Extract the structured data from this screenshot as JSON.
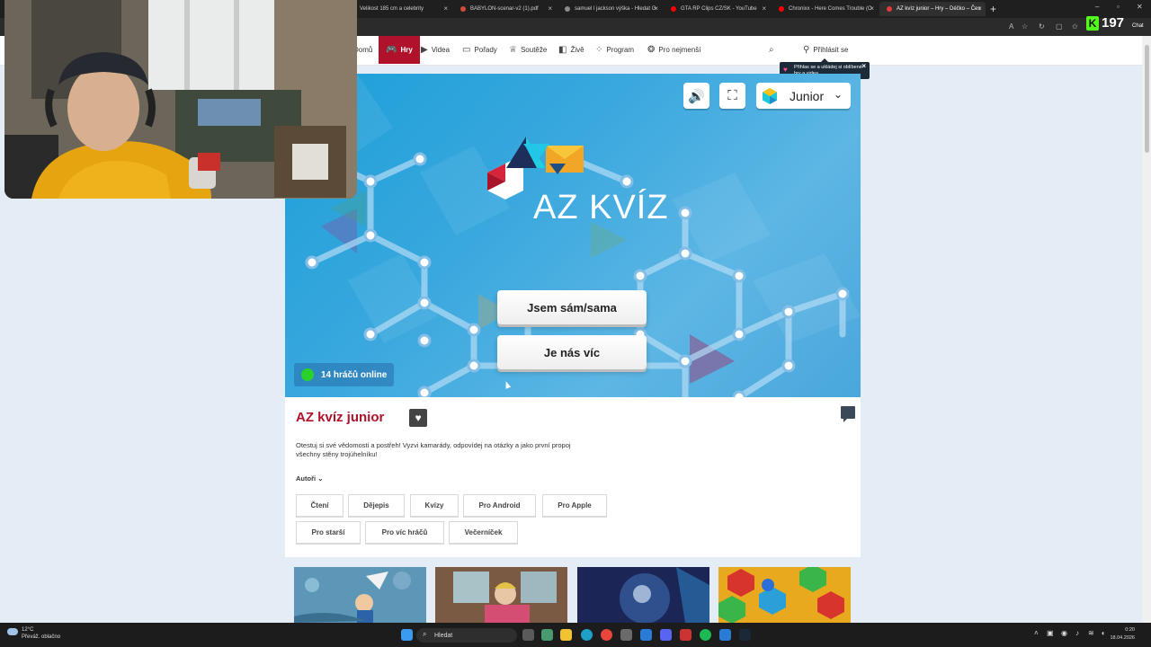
{
  "browser": {
    "tabs": [
      {
        "label": "Velikost 185 cm a celebrity",
        "fav": "#8a8a8a"
      },
      {
        "label": "BABYLON-scenar-v2 (1).pdf",
        "fav": "#d24b3a"
      },
      {
        "label": "samuel l jackson výška - Hledat G",
        "fav": "#8a8a8a"
      },
      {
        "label": "GTA RP Clips CZ/SK - YouTube",
        "fav": "#ff0000"
      },
      {
        "label": "Chronixx - Here Comes Trouble (O",
        "fav": "#ff0000"
      },
      {
        "label": "AZ kvíz junior – Hry – Déčko – Čes",
        "fav": "#e23b3b"
      }
    ],
    "new_tab": "+",
    "kick_count": "197",
    "kick_logo": "K",
    "chat_label": "Chat"
  },
  "nav": {
    "items": [
      {
        "label": "Domů",
        "icon": "home-icon"
      },
      {
        "label": "Hry",
        "icon": "gamepad-icon"
      },
      {
        "label": "Videa",
        "icon": "play-icon"
      },
      {
        "label": "Pořady",
        "icon": "tv-icon"
      },
      {
        "label": "Soutěže",
        "icon": "trophy-icon"
      },
      {
        "label": "Živě",
        "icon": "live-icon"
      },
      {
        "label": "Program",
        "icon": "grid-icon"
      },
      {
        "label": "Pro nejmenší",
        "icon": "bear-icon"
      }
    ],
    "login_label": "Přihlásit se"
  },
  "tooltip": {
    "text": "Přihlas se a ukládej si oblíbené hry a videa."
  },
  "game": {
    "logo_text": "AZ KVÍZ",
    "level": "Junior",
    "choices": [
      "Jsem sám/sama",
      "Je nás víc"
    ],
    "online_text": "14 hráčů online"
  },
  "info": {
    "title": "AZ kvíz junior",
    "description": "Otestuj si své vědomosti a postřeh! Vyzvi kamarády, odpovídej na otázky a jako první propoj všechny stěny trojúhelníku!",
    "authors_label": "Autoři",
    "tags": [
      "Čtení",
      "Dějepis",
      "Kvízy",
      "Pro Android",
      "Pro Apple",
      "Pro starší",
      "Pro víc hráčů",
      "Večerníček"
    ]
  },
  "taskbar": {
    "weather_temp": "12°C",
    "weather_desc": "Převáž. oblačno",
    "search_placeholder": "Hledat",
    "time": "0:20",
    "date": "18.04.2026"
  },
  "colors": {
    "brand_red": "#b0112b",
    "game_blue": "#2a9fd8"
  }
}
